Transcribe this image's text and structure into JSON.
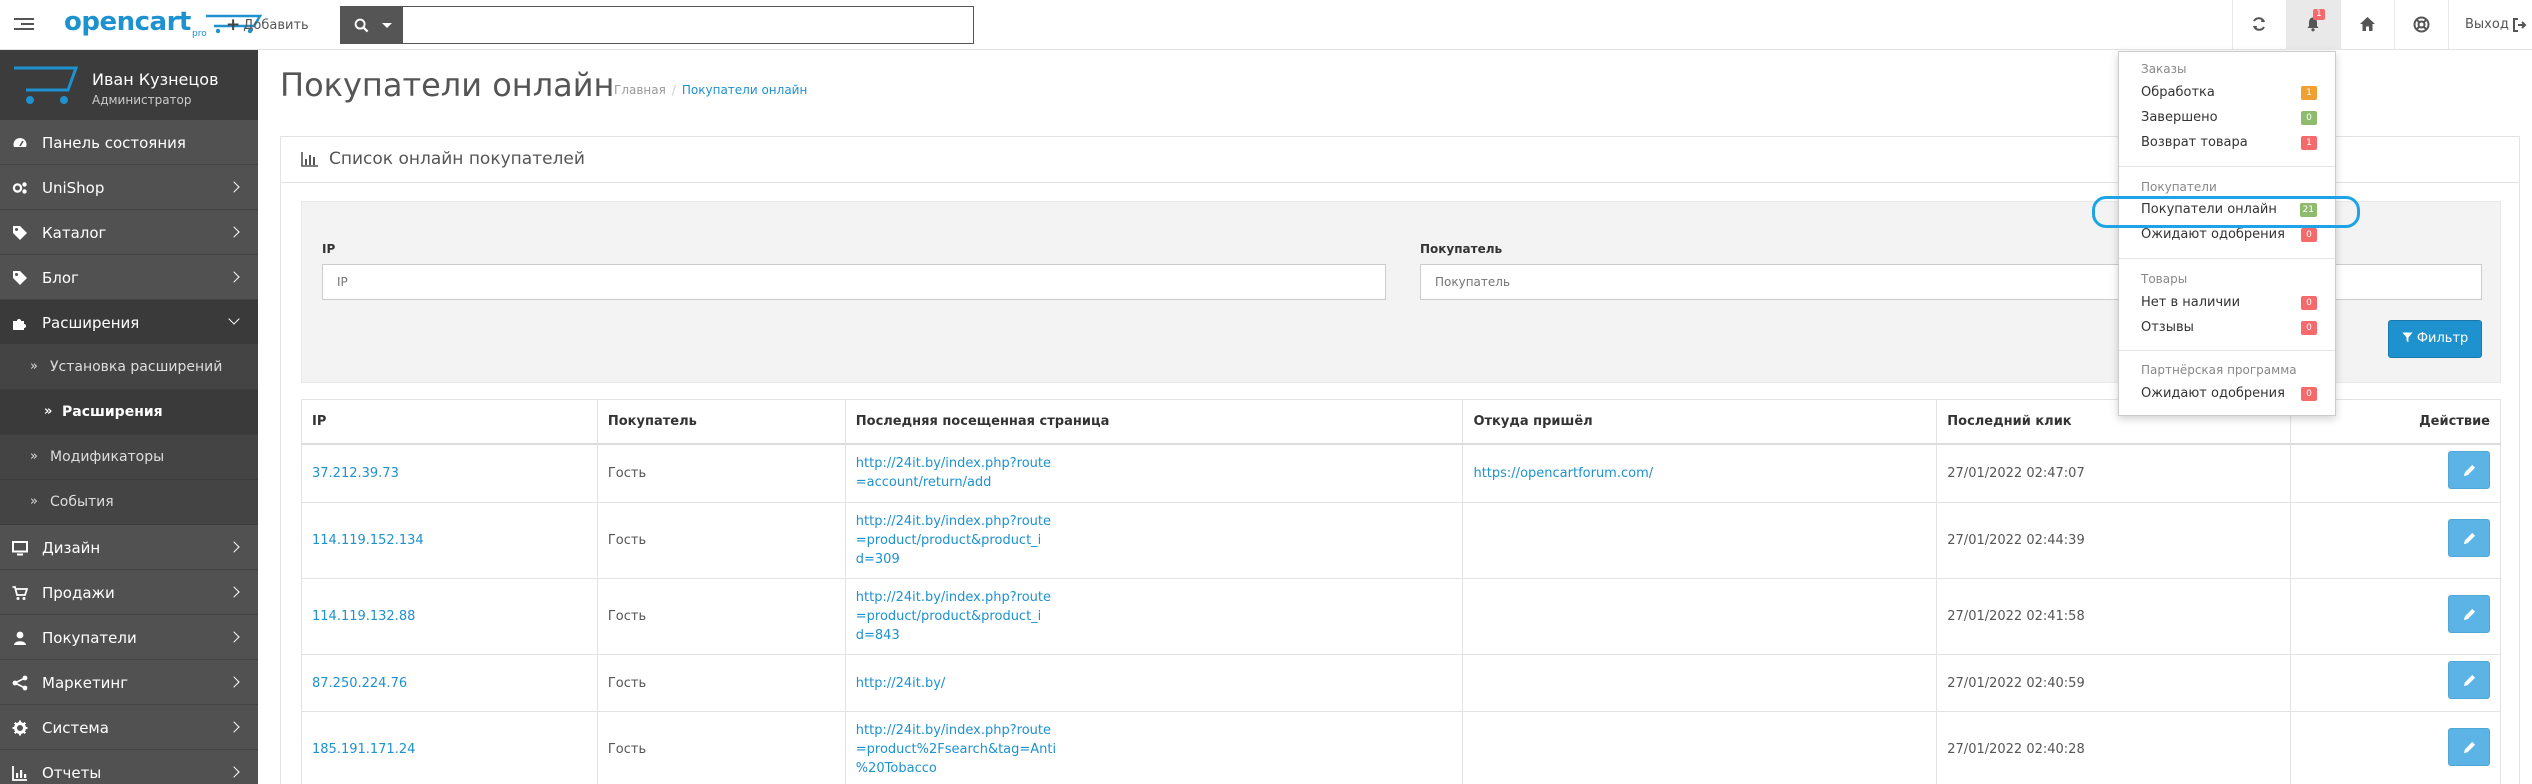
{
  "header": {
    "logo_text": "opencart",
    "logo_suffix": "pro",
    "add_label": "Добавить",
    "search_placeholder": "",
    "search_value": "",
    "notification_count": "1",
    "logout_label": "Выход"
  },
  "sidebar": {
    "user_name": "Иван Кузнецов",
    "user_role": "Администратор",
    "items": [
      {
        "label": "Панель состояния",
        "icon": "dashboard-icon"
      },
      {
        "label": "UniShop",
        "icon": "gears-icon"
      },
      {
        "label": "Каталог",
        "icon": "tag-icon"
      },
      {
        "label": "Блог",
        "icon": "tag-icon"
      },
      {
        "label": "Расширения",
        "icon": "puzzle-icon"
      },
      {
        "label": "Дизайн",
        "icon": "monitor-icon"
      },
      {
        "label": "Продажи",
        "icon": "cart-icon"
      },
      {
        "label": "Покупатели",
        "icon": "user-icon"
      },
      {
        "label": "Маркетинг",
        "icon": "share-icon"
      },
      {
        "label": "Система",
        "icon": "cog-icon"
      },
      {
        "label": "Отчеты",
        "icon": "chart-icon"
      }
    ],
    "subitems": [
      {
        "label": "Установка расширений"
      },
      {
        "label": "Расширения"
      },
      {
        "label": "Модификаторы"
      },
      {
        "label": "События"
      }
    ]
  },
  "page": {
    "title": "Покупатели онлайн",
    "breadcrumb_home": "Главная",
    "breadcrumb_sep": "/",
    "breadcrumb_current": "Покупатели онлайн"
  },
  "panel": {
    "title": "Список онлайн покупателей",
    "filter": {
      "ip_label": "IP",
      "ip_placeholder": "IP",
      "ip_value": "",
      "customer_label": "Покупатель",
      "customer_placeholder": "Покупатель",
      "customer_value": "",
      "button_label": "Фильтр"
    },
    "table": {
      "columns": [
        "IP",
        "Покупатель",
        "Последняя посещенная страница",
        "Откуда пришёл",
        "Последний клик",
        "Действие"
      ],
      "rows": [
        {
          "ip": "37.212.39.73",
          "customer": "Гость",
          "url": "http://24it.by/index.php?route\n=account/return/add",
          "referer": "https://opencartforum.com/",
          "date": "27/01/2022 02:47:07"
        },
        {
          "ip": "114.119.152.134",
          "customer": "Гость",
          "url": "http://24it.by/index.php?route\n=product/product&product_i\nd=309",
          "referer": "",
          "date": "27/01/2022 02:44:39"
        },
        {
          "ip": "114.119.132.88",
          "customer": "Гость",
          "url": "http://24it.by/index.php?route\n=product/product&product_i\nd=843",
          "referer": "",
          "date": "27/01/2022 02:41:58"
        },
        {
          "ip": "87.250.224.76",
          "customer": "Гость",
          "url": "http://24it.by/",
          "referer": "",
          "date": "27/01/2022 02:40:59"
        },
        {
          "ip": "185.191.171.24",
          "customer": "Гость",
          "url": "http://24it.by/index.php?route\n=product%2Fsearch&tag=Anti\n%20Tobacco",
          "referer": "",
          "date": "27/01/2022 02:40:28"
        }
      ]
    }
  },
  "notifications": {
    "sections": [
      {
        "title": "Заказы",
        "items": [
          {
            "label": "Обработка",
            "count": "1",
            "color": "#f0a030"
          },
          {
            "label": "Завершено",
            "count": "0",
            "color": "#8fbb6c"
          },
          {
            "label": "Возврат товара",
            "count": "1",
            "color": "#f56b6b"
          }
        ]
      },
      {
        "title": "Покупатели",
        "items": [
          {
            "label": "Покупатели онлайн",
            "count": "21",
            "color": "#8fbb6c"
          },
          {
            "label": "Ожидают одобрения",
            "count": "0",
            "color": "#f56b6b"
          }
        ]
      },
      {
        "title": "Товары",
        "items": [
          {
            "label": "Нет в наличии",
            "count": "0",
            "color": "#f56b6b"
          },
          {
            "label": "Отзывы",
            "count": "0",
            "color": "#f56b6b"
          }
        ]
      },
      {
        "title": "Партнёрская программа",
        "items": [
          {
            "label": "Ожидают одобрения",
            "count": "0",
            "color": "#f56b6b"
          }
        ]
      }
    ]
  },
  "colors": {
    "accent": "#1e91cf",
    "sidebar_bg": "#515151",
    "highlight_ring": "#1ea4e6"
  }
}
